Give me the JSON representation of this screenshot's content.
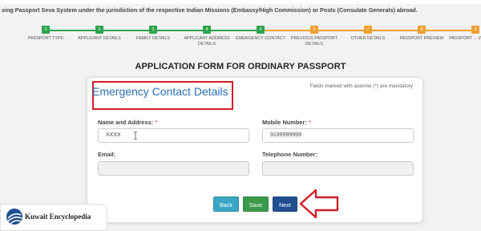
{
  "banner_text": "sing Passport Seva System under the jurisdiction of the respective Indian Missions (Embassy/High Commission) or Posts (Consulate Generals) abroad.",
  "colors": {
    "done": "#2ea44f",
    "todo": "#f0a030",
    "title": "#2a6fb5",
    "highlight": "#d0202a"
  },
  "steps": [
    {
      "num": "1",
      "label": "PASSPORT TYPE",
      "status": "done"
    },
    {
      "num": "2",
      "label": "APPLICANT DETAILS",
      "status": "done"
    },
    {
      "num": "3",
      "label": "FAMILY DETAILS",
      "status": "done"
    },
    {
      "num": "4",
      "label": "APPLICANT ADDRESS DETAILS",
      "status": "done"
    },
    {
      "num": "5",
      "label": "EMERGENCY CONTACT",
      "status": "done"
    },
    {
      "num": "6",
      "label": "PREVIOUS PASSPORT DETAILS",
      "status": "todo"
    },
    {
      "num": "7",
      "label": "OTHER DETAILS",
      "status": "todo"
    },
    {
      "num": "8",
      "label": "PASSPORT PREVIEW",
      "status": "todo"
    },
    {
      "num": "9",
      "label": "PASSPORT ... VERIFICA...",
      "status": "todo"
    }
  ],
  "form": {
    "heading": "APPLICATION FORM FOR ORDINARY PASSPORT",
    "mandatory_note": "Fields marked with asterisk (*) are mandatory",
    "section_title": "Emergency Contact Details",
    "name_label": "Name and Address:",
    "name_value": "XXXX",
    "mobile_label": "Mobile Number:",
    "mobile_value": "9199999999",
    "required_mark": "*",
    "email_label": "Email:",
    "email_value": "",
    "telephone_label": "Telephone Number:",
    "telephone_value": ""
  },
  "buttons": {
    "back": "Back",
    "save": "Save",
    "next": "Next"
  },
  "logo": {
    "text": "Kuwait Encyclopedia"
  }
}
